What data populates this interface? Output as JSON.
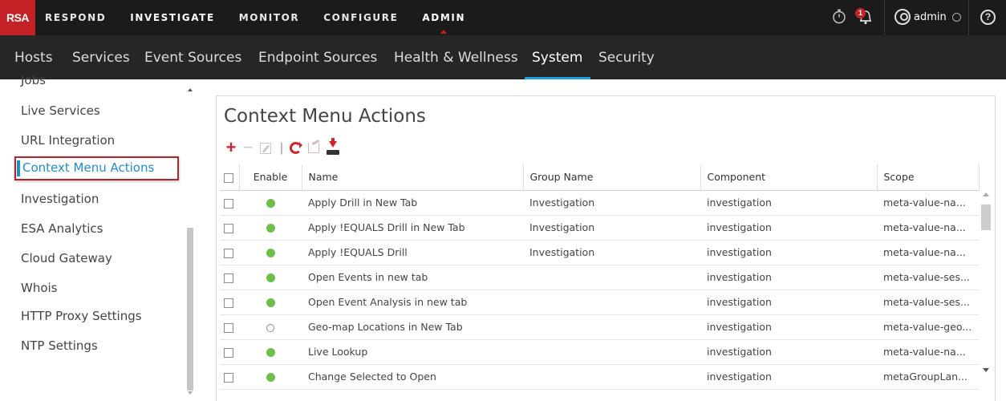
{
  "brand": "RSA",
  "topnav": [
    "RESPOND",
    "INVESTIGATE",
    "MONITOR",
    "CONFIGURE",
    "ADMIN"
  ],
  "topnav_active": "ADMIN",
  "notification_count": "1",
  "user": "admin",
  "help_glyph": "?",
  "subnav": [
    "Hosts",
    "Services",
    "Event Sources",
    "Endpoint Sources",
    "Health & Wellness",
    "System",
    "Security"
  ],
  "subnav_active": "System",
  "sidebar": {
    "items": [
      "Jobs",
      "Live Services",
      "URL Integration",
      "Context Menu Actions",
      "Investigation",
      "ESA Analytics",
      "Cloud Gateway",
      "Whois",
      "HTTP Proxy Settings",
      "NTP Settings"
    ],
    "selected": "Context Menu Actions"
  },
  "main": {
    "title": "Context Menu Actions",
    "toolbar": {
      "pipe": "|",
      "add_glyph": "+",
      "remove_glyph": "−"
    },
    "table": {
      "columns": [
        "Enable",
        "Name",
        "Group Name",
        "Component",
        "Scope"
      ],
      "rows": [
        {
          "enabled": true,
          "name": "Apply Drill in New Tab",
          "group": "Investigation",
          "component": "investigation",
          "scope": "meta-value-na..."
        },
        {
          "enabled": true,
          "name": "Apply !EQUALS Drill in New Tab",
          "group": "Investigation",
          "component": "investigation",
          "scope": "meta-value-na..."
        },
        {
          "enabled": true,
          "name": "Apply !EQUALS Drill",
          "group": "Investigation",
          "component": "investigation",
          "scope": "meta-value-na..."
        },
        {
          "enabled": true,
          "name": "Open Events in new tab",
          "group": "",
          "component": "investigation",
          "scope": "meta-value-ses..."
        },
        {
          "enabled": true,
          "name": "Open Event Analysis in new tab",
          "group": "",
          "component": "investigation",
          "scope": "meta-value-ses..."
        },
        {
          "enabled": false,
          "name": "Geo-map Locations in New Tab",
          "group": "",
          "component": "investigation",
          "scope": "meta-value-geo..."
        },
        {
          "enabled": true,
          "name": "Live Lookup",
          "group": "",
          "component": "investigation",
          "scope": "meta-value-na..."
        },
        {
          "enabled": true,
          "name": "Change Selected to Open",
          "group": "",
          "component": "investigation",
          "scope": "metaGroupLan..."
        }
      ]
    }
  },
  "colors": {
    "accent_red": "#c42127",
    "accent_blue": "#1f8fd1",
    "enabled_green": "#6cc04a"
  },
  "icons": [
    "stopwatch-icon",
    "bell-icon",
    "user-icon",
    "help-icon",
    "add-icon",
    "remove-icon",
    "edit-icon",
    "refresh-icon",
    "export-icon",
    "import-icon"
  ]
}
